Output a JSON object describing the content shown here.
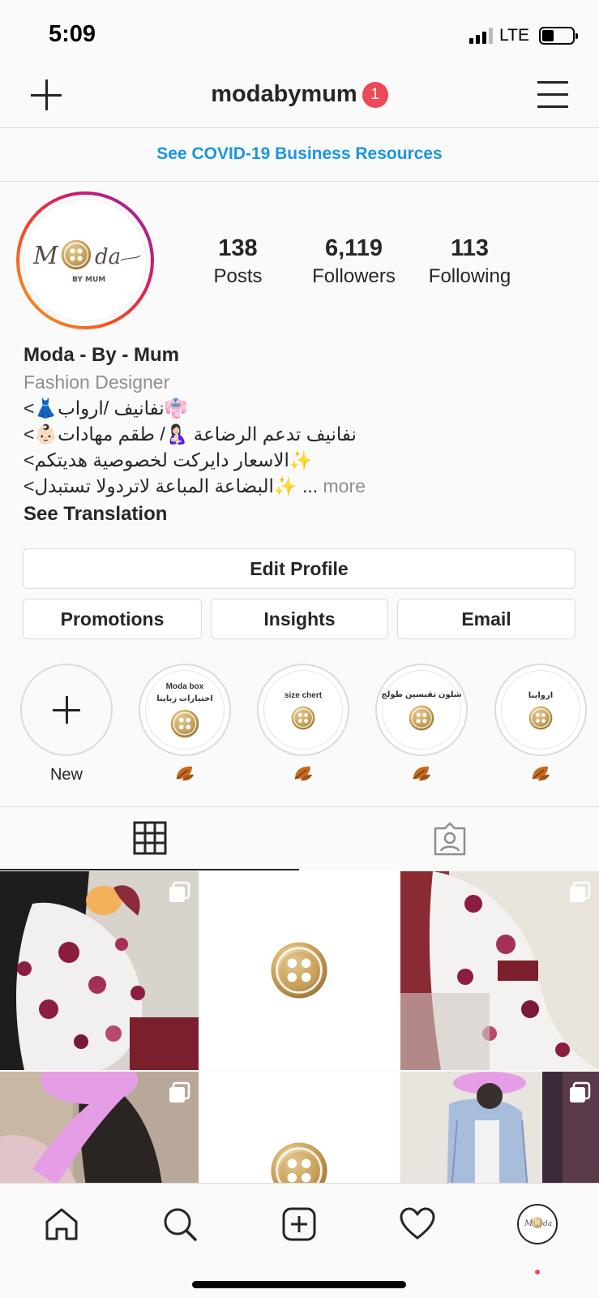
{
  "status_bar": {
    "time": "5:09",
    "network": "LTE",
    "signal_bars": 3,
    "battery_level": 0.3
  },
  "header": {
    "username": "modabymum",
    "notification_count": "1"
  },
  "covid_banner": {
    "text": "See COVID-19 Business Resources",
    "color": "#1b95e0"
  },
  "avatar": {
    "logo_left": "M",
    "logo_right": "da",
    "logo_sub": "BY MUM"
  },
  "stats": {
    "posts": {
      "count": "138",
      "label": "Posts"
    },
    "followers": {
      "count": "6,119",
      "label": "Followers"
    },
    "following": {
      "count": "113",
      "label": "Following"
    }
  },
  "bio": {
    "name": "Moda - By - Mum",
    "category": "Fashion Designer",
    "line1": "<👗نفانيف /ارواب👘",
    "line2": "<👶🏻نفانيف تدعم الرضاعة 🤱🏻/ طقم مهادات",
    "line3": "<الاسعار دايركت لخصوصية هديتكم✨",
    "line4_text": "<البضاعة المباعة لاتردولا تستبدل✨ ...",
    "line4_more": "more",
    "see_translation": "See Translation"
  },
  "buttons": {
    "edit_profile": "Edit Profile",
    "promotions": "Promotions",
    "insights": "Insights",
    "email": "Email"
  },
  "highlights": [
    {
      "label": "New",
      "icon": "plus-icon"
    },
    {
      "title_top": "Moda box",
      "title": "اختيارات زباينا",
      "label_icon": "fallen-leaf-icon"
    },
    {
      "title": "size chert",
      "label_icon": "fallen-leaf-icon"
    },
    {
      "title": "شلون تقيسين طولج",
      "label_icon": "fallen-leaf-icon"
    },
    {
      "title": "ارواينا",
      "label_icon": "fallen-leaf-icon"
    }
  ],
  "tabs": {
    "active": "grid",
    "items": [
      "grid-icon",
      "tagged-icon"
    ]
  },
  "grid_posts": [
    {
      "kind": "photo",
      "description_icon": "multi-photo-icon"
    },
    {
      "kind": "logo"
    },
    {
      "kind": "photo",
      "description_icon": "multi-photo-icon"
    },
    {
      "kind": "photo",
      "description_icon": "multi-photo-icon"
    },
    {
      "kind": "logo"
    },
    {
      "kind": "photo",
      "description_icon": "multi-photo-icon"
    }
  ],
  "bottom_nav": [
    "home-icon",
    "search-icon",
    "new-post-icon",
    "activity-heart-icon",
    "profile-avatar-icon"
  ],
  "colors": {
    "accent_blue": "#1b95e0",
    "badge_red": "#ed4956",
    "border": "#dbdbdb",
    "muted_text": "#8e8e8e"
  }
}
